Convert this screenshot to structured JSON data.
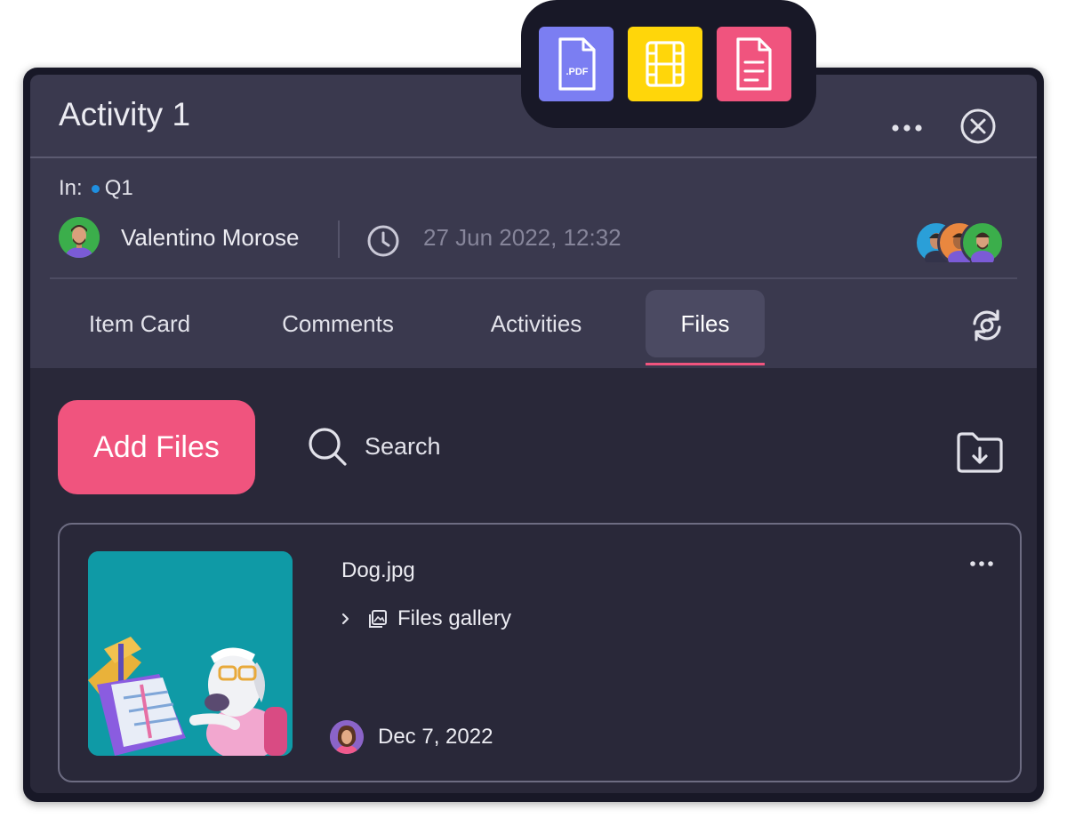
{
  "window": {
    "title": "Activity 1",
    "more_icon": "more-horizontal-icon",
    "close_icon": "close-circle-icon"
  },
  "meta": {
    "in_label": "In:",
    "group": "Q1",
    "group_color": "#1f8fe0",
    "user_name": "Valentino Morose",
    "datetime": "27 Jun 2022, 12:32"
  },
  "tabs": [
    {
      "label": "Item Card",
      "active": false
    },
    {
      "label": "Comments",
      "active": false
    },
    {
      "label": "Activities",
      "active": false
    },
    {
      "label": "Files",
      "active": true
    }
  ],
  "toolbar": {
    "add_files_label": "Add Files",
    "search_label": "Search"
  },
  "file": {
    "name": "Dog.jpg",
    "location": "Files gallery",
    "date": "Dec 7, 2022"
  },
  "file_types": [
    {
      "icon": "pdf-file-icon",
      "color": "#7b7ef2",
      "text": ".PDF"
    },
    {
      "icon": "video-file-icon",
      "color": "#ffd60a"
    },
    {
      "icon": "document-file-icon",
      "color": "#f0547e"
    }
  ],
  "colors": {
    "accent": "#f0547e",
    "panel": "#3a394e",
    "body": "#292839",
    "frame": "#181827"
  }
}
